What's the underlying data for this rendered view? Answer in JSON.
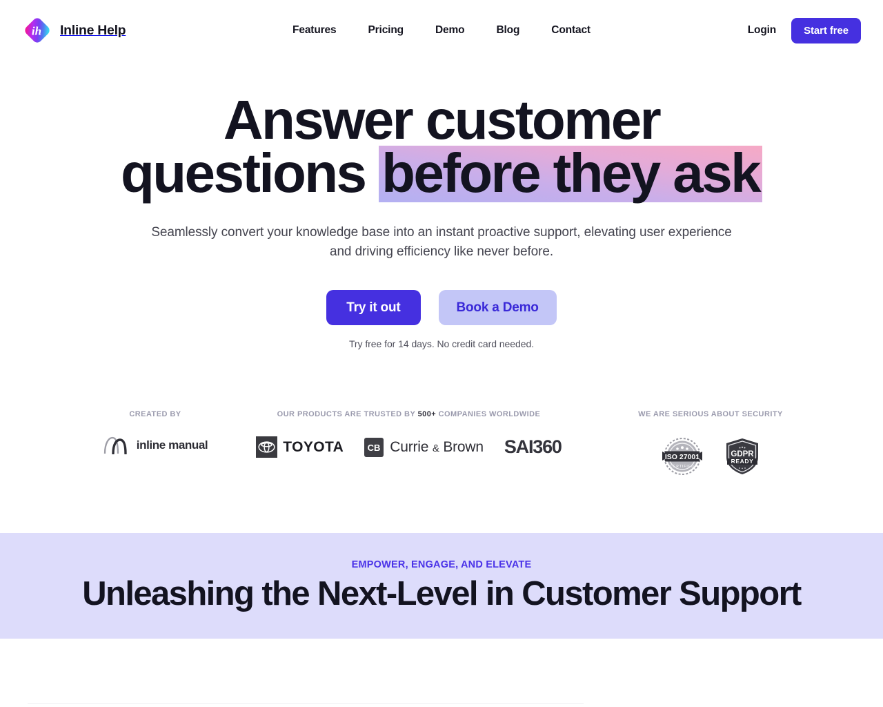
{
  "header": {
    "brand": {
      "name": "Inline Help",
      "mark_letters": "ih"
    },
    "nav": [
      {
        "label": "Features"
      },
      {
        "label": "Pricing"
      },
      {
        "label": "Demo"
      },
      {
        "label": "Blog"
      },
      {
        "label": "Contact"
      }
    ],
    "login_label": "Login",
    "cta_label": "Start free"
  },
  "hero": {
    "title_line1": "Answer customer",
    "title_line2_plain": "questions ",
    "title_line2_highlight": "before they ask",
    "subtitle": "Seamlessly convert your knowledge base into an instant proactive support, elevating user experience and driving efficiency like never before.",
    "primary_cta": "Try it out",
    "secondary_cta": "Book a Demo",
    "note": "Try free for 14 days. No credit card needed."
  },
  "logo_strip": {
    "created": {
      "label": "CREATED BY",
      "logos": [
        {
          "name": "inline manual",
          "word": "inline manual"
        }
      ]
    },
    "trusted": {
      "label_pre": "OUR PRODUCTS ARE TRUSTED BY ",
      "label_strong": "500+",
      "label_post": " COMPANIES WORLDWIDE",
      "logos": [
        {
          "name": "Toyota",
          "word": "TOYOTA"
        },
        {
          "name": "Currie & Brown",
          "word": "Currie",
          "word2": "Brown",
          "amp": "&",
          "mark": "CB"
        },
        {
          "name": "SAI360",
          "word": "SAI360"
        }
      ]
    },
    "security": {
      "label": "WE ARE SERIOUS ABOUT SECURITY",
      "badges": [
        {
          "name": "ISO 27001 certified",
          "title": "ISO 27001",
          "sub": "CERTIFIED"
        },
        {
          "name": "GDPR ready",
          "title": "GDPR",
          "sub": "READY"
        }
      ]
    }
  },
  "band": {
    "eyebrow": "EMPOWER, ENGAGE, AND ELEVATE",
    "title": "Unleashing the Next-Level in Customer Support",
    "bg_color": "#dddcfb",
    "eyebrow_color": "#4a32e8"
  },
  "colors": {
    "accent": "#4530e0",
    "accent_soft": "#c3c6f7",
    "ink": "#131320",
    "muted": "#9a9aad",
    "highlight_from": "#b3b0f2",
    "highlight_to": "#f6a9c5"
  }
}
